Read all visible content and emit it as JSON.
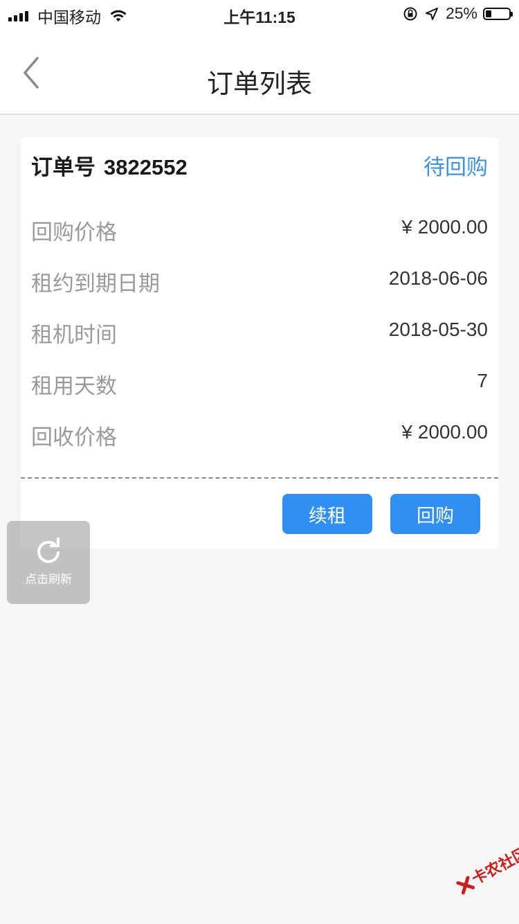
{
  "status_bar": {
    "carrier": "中国移动",
    "time": "上午11:15",
    "battery_percent": "25%",
    "battery_level": 0.25
  },
  "navbar": {
    "title": "订单列表"
  },
  "order": {
    "order_label": "订单号",
    "order_number": "3822552",
    "status": "待回购",
    "details": [
      {
        "label": "回购价格",
        "value": "¥ 2000.00"
      },
      {
        "label": "租约到期日期",
        "value": "2018-06-06"
      },
      {
        "label": "租机时间",
        "value": "2018-05-30"
      },
      {
        "label": "租用天数",
        "value": "7"
      },
      {
        "label": "回收价格",
        "value": "¥ 2000.00"
      }
    ],
    "actions": {
      "renew_label": "续租",
      "buyback_label": "回购"
    }
  },
  "refresh": {
    "label": "点击刷新"
  },
  "watermark": {
    "text": "卡农社区"
  },
  "colors": {
    "accent": "#2f8ff3",
    "status_text": "#3a93e6",
    "background": "#f6f6f6"
  }
}
